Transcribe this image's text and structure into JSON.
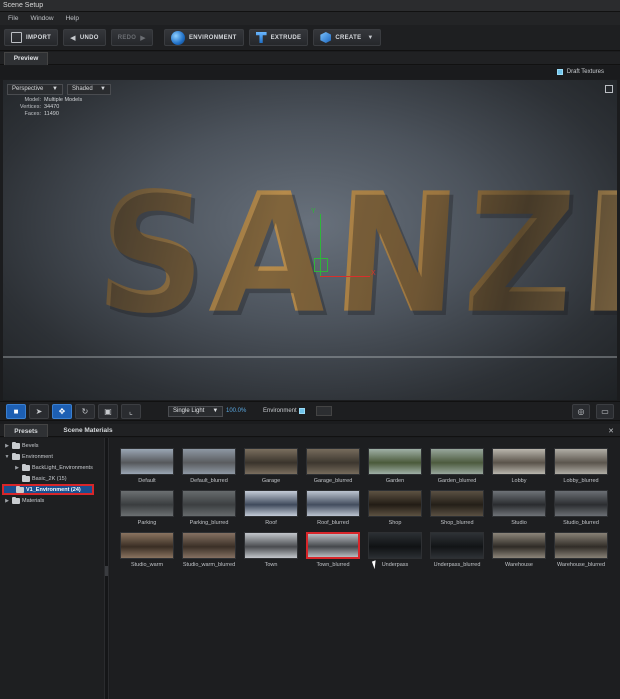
{
  "window": {
    "title": "Scene Setup"
  },
  "menu": [
    "File",
    "Window",
    "Help"
  ],
  "toolbar": {
    "import": "IMPORT",
    "undo": "UNDO",
    "redo": "REDO",
    "environment": "ENVIRONMENT",
    "extrude": "EXTRUDE",
    "create": "CREATE"
  },
  "tabs": {
    "preview": "Preview"
  },
  "viewport": {
    "draft_textures": "Draft Textures",
    "projection": "Perspective",
    "shading": "Shaded",
    "stats": [
      {
        "k": "Model:",
        "v": "Multiple Models"
      },
      {
        "k": "Vertices:",
        "v": "34470"
      },
      {
        "k": "Faces:",
        "v": "11490"
      }
    ],
    "scene_text": "SANZE",
    "gizmo_x": "X",
    "gizmo_y": "Y"
  },
  "vp_toolbar": {
    "light": "Single Light",
    "percent": "100.0%",
    "environment": "Environment"
  },
  "panel_tabs": {
    "presets": "Presets",
    "scene_materials": "Scene Materials"
  },
  "tree": [
    {
      "label": "Bevels",
      "indent": 0,
      "expanded": false
    },
    {
      "label": "Environment",
      "indent": 0,
      "expanded": true
    },
    {
      "label": "BackLight_Environments",
      "indent": 1,
      "expanded": false
    },
    {
      "label": "Basic_2K (15)",
      "indent": 1,
      "expanded": false
    },
    {
      "label": "V1_Environment (24)",
      "indent": 1,
      "expanded": false,
      "selected": true
    },
    {
      "label": "Materials",
      "indent": 0,
      "expanded": false
    }
  ],
  "environments": [
    {
      "label": "Default",
      "c1": "#9aa6b4",
      "c2": "#56585b"
    },
    {
      "label": "Default_blurred",
      "c1": "#8e98a4",
      "c2": "#5a5c5f"
    },
    {
      "label": "Garage",
      "c1": "#7a6e5e",
      "c2": "#3a342c"
    },
    {
      "label": "Garage_blurred",
      "c1": "#766b5c",
      "c2": "#3d372f"
    },
    {
      "label": "Garden",
      "c1": "#9fb0a6",
      "c2": "#4b5a3a"
    },
    {
      "label": "Garden_blurred",
      "c1": "#98a79c",
      "c2": "#4d5b3e"
    },
    {
      "label": "Lobby",
      "c1": "#b9b6ad",
      "c2": "#5a534a"
    },
    {
      "label": "Lobby_blurred",
      "c1": "#b0ada5",
      "c2": "#5b554d"
    },
    {
      "label": "Parking",
      "c1": "#6c7072",
      "c2": "#3a3d3f"
    },
    {
      "label": "Parking_blurred",
      "c1": "#676b6d",
      "c2": "#3c3f41"
    },
    {
      "label": "Roof",
      "c1": "#c4ccd8",
      "c2": "#3f4a5c"
    },
    {
      "label": "Roof_blurred",
      "c1": "#bcc4d0",
      "c2": "#434d5e"
    },
    {
      "label": "Shop",
      "c1": "#5d5242",
      "c2": "#221c15"
    },
    {
      "label": "Shop_blurred",
      "c1": "#5a5043",
      "c2": "#241f18"
    },
    {
      "label": "Studio",
      "c1": "#6f7378",
      "c2": "#2a2c2f"
    },
    {
      "label": "Studio_blurred",
      "c1": "#6b6f74",
      "c2": "#2c2e31"
    },
    {
      "label": "Studio_warm",
      "c1": "#8a7460",
      "c2": "#3a2e24"
    },
    {
      "label": "Studio_warm_blurred",
      "c1": "#857162",
      "c2": "#3b3027"
    },
    {
      "label": "Town",
      "c1": "#c3c7cc",
      "c2": "#4a4c50"
    },
    {
      "label": "Town_blurred",
      "c1": "#b8bcc1",
      "c2": "#45484c",
      "selected": true
    },
    {
      "label": "Underpass",
      "c1": "#2b2f33",
      "c2": "#101214"
    },
    {
      "label": "Underpass_blurred",
      "c1": "#2e3236",
      "c2": "#121416"
    },
    {
      "label": "Warehouse",
      "c1": "#8c857a",
      "c2": "#2f2b26"
    },
    {
      "label": "Warehouse_blurred",
      "c1": "#888176",
      "c2": "#312d28"
    }
  ]
}
